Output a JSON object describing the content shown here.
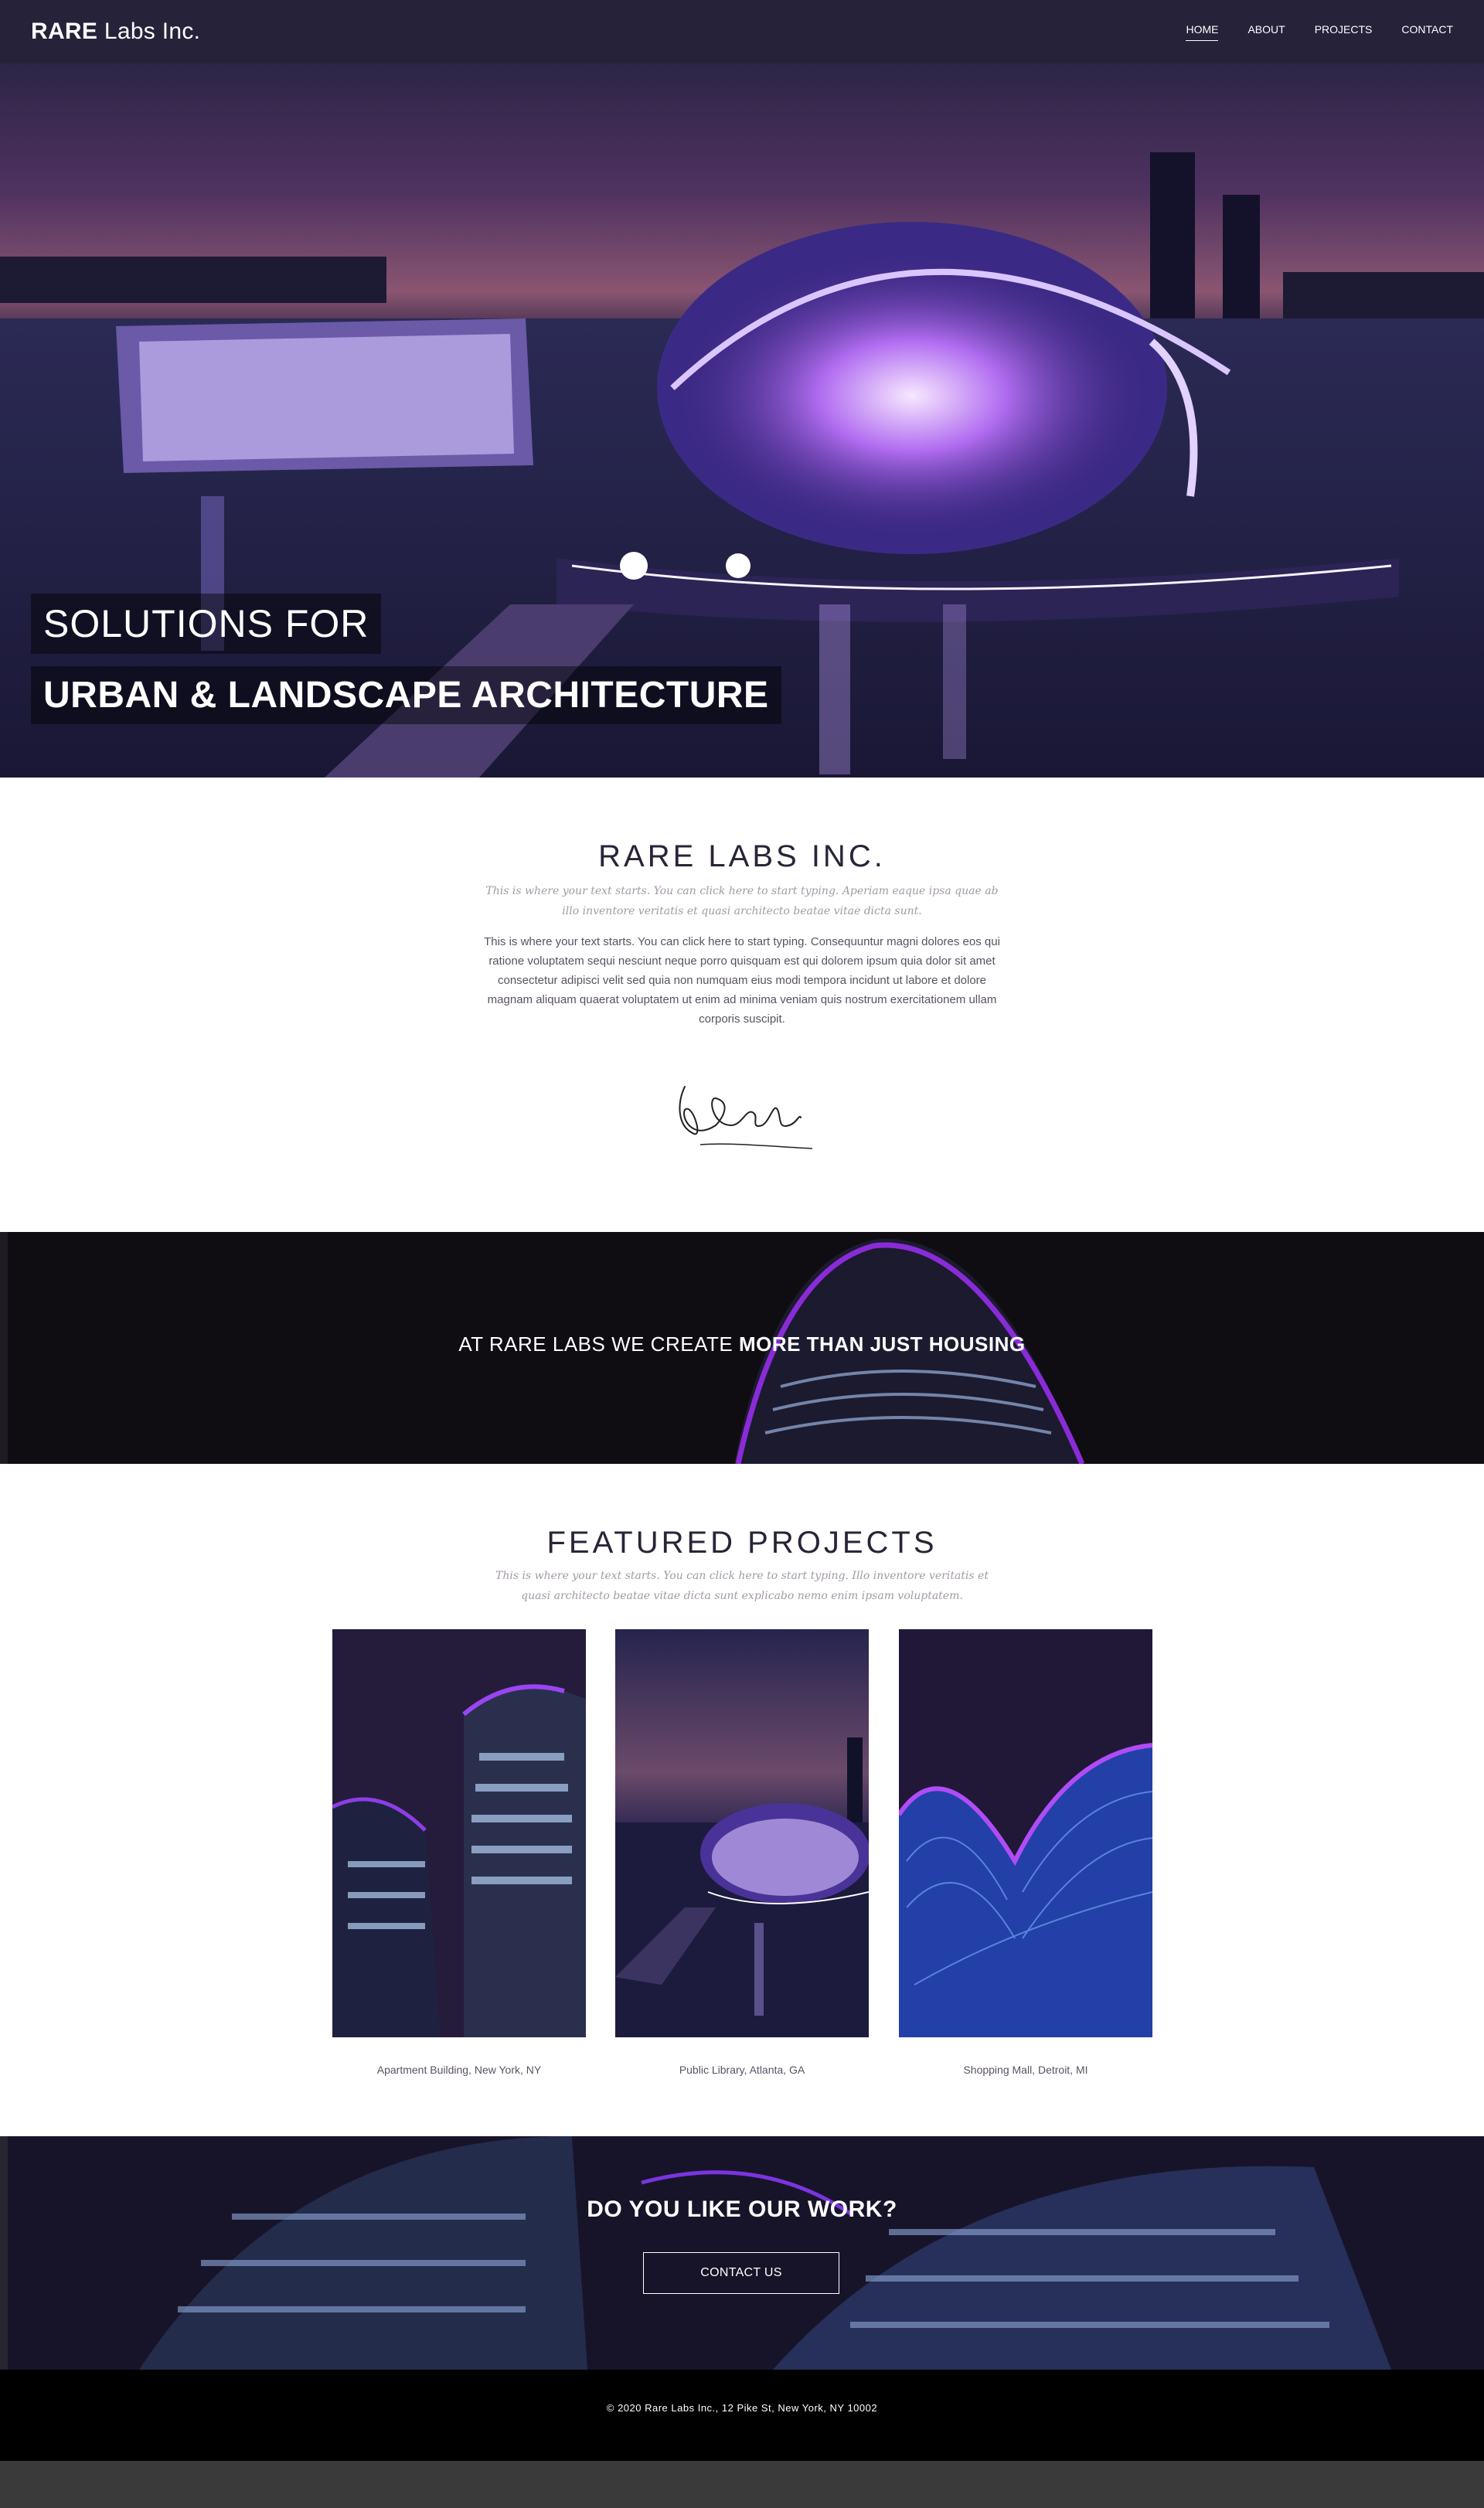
{
  "header": {
    "logo_bold": "RARE",
    "logo_rest": " Labs Inc.",
    "nav": [
      {
        "label": "HOME",
        "active": true
      },
      {
        "label": "ABOUT",
        "active": false
      },
      {
        "label": "PROJECTS",
        "active": false
      },
      {
        "label": "CONTACT",
        "active": false
      }
    ]
  },
  "hero": {
    "line1": "SOLUTIONS FOR",
    "line2": "URBAN & LANDSCAPE ARCHITECTURE",
    "image": "night-architecture-photo"
  },
  "intro": {
    "title": "RARE LABS INC.",
    "subtitle": "This is where your text starts. You can click here to start typing. Aperiam eaque ipsa quae ab illo inventore veritatis et quasi architecto beatae vitae dicta sunt.",
    "body": "This is where your text starts. You can click here to start typing. Consequuntur magni dolores eos qui ratione voluptatem sequi nesciunt neque porro quisquam est qui dolorem ipsum quia dolor sit amet consectetur adipisci velit sed quia non numquam eius modi tempora incidunt ut labore et dolore magnam aliquam quaerat voluptatem ut enim ad minima veniam quis nostrum exercitationem ullam corporis suscipit.",
    "signature": "J.Smith"
  },
  "band1": {
    "text_normal": "AT RARE LABS WE CREATE ",
    "text_bold": "MORE THAN JUST HOUSING"
  },
  "featured": {
    "title": "FEATURED PROJECTS",
    "subtitle": "This is where your text starts. You can click here to start typing. Illo inventore veritatis et quasi architecto beatae vitae dicta sunt explicabo nemo enim ipsam voluptatem.",
    "projects": [
      {
        "caption": "Apartment Building, New York, NY"
      },
      {
        "caption": "Public Library, Atlanta, GA"
      },
      {
        "caption": "Shopping Mall, Detroit, MI"
      }
    ]
  },
  "cta": {
    "title": "DO YOU LIKE OUR WORK?",
    "button": "CONTACT US"
  },
  "footer": {
    "text": "© 2020 Rare Labs Inc.,  12 Pike St, New York, NY 10002"
  },
  "colors": {
    "header_bg": "#25223a",
    "accent_purple": "#9b3cf0",
    "footer_bg": "#000000"
  }
}
